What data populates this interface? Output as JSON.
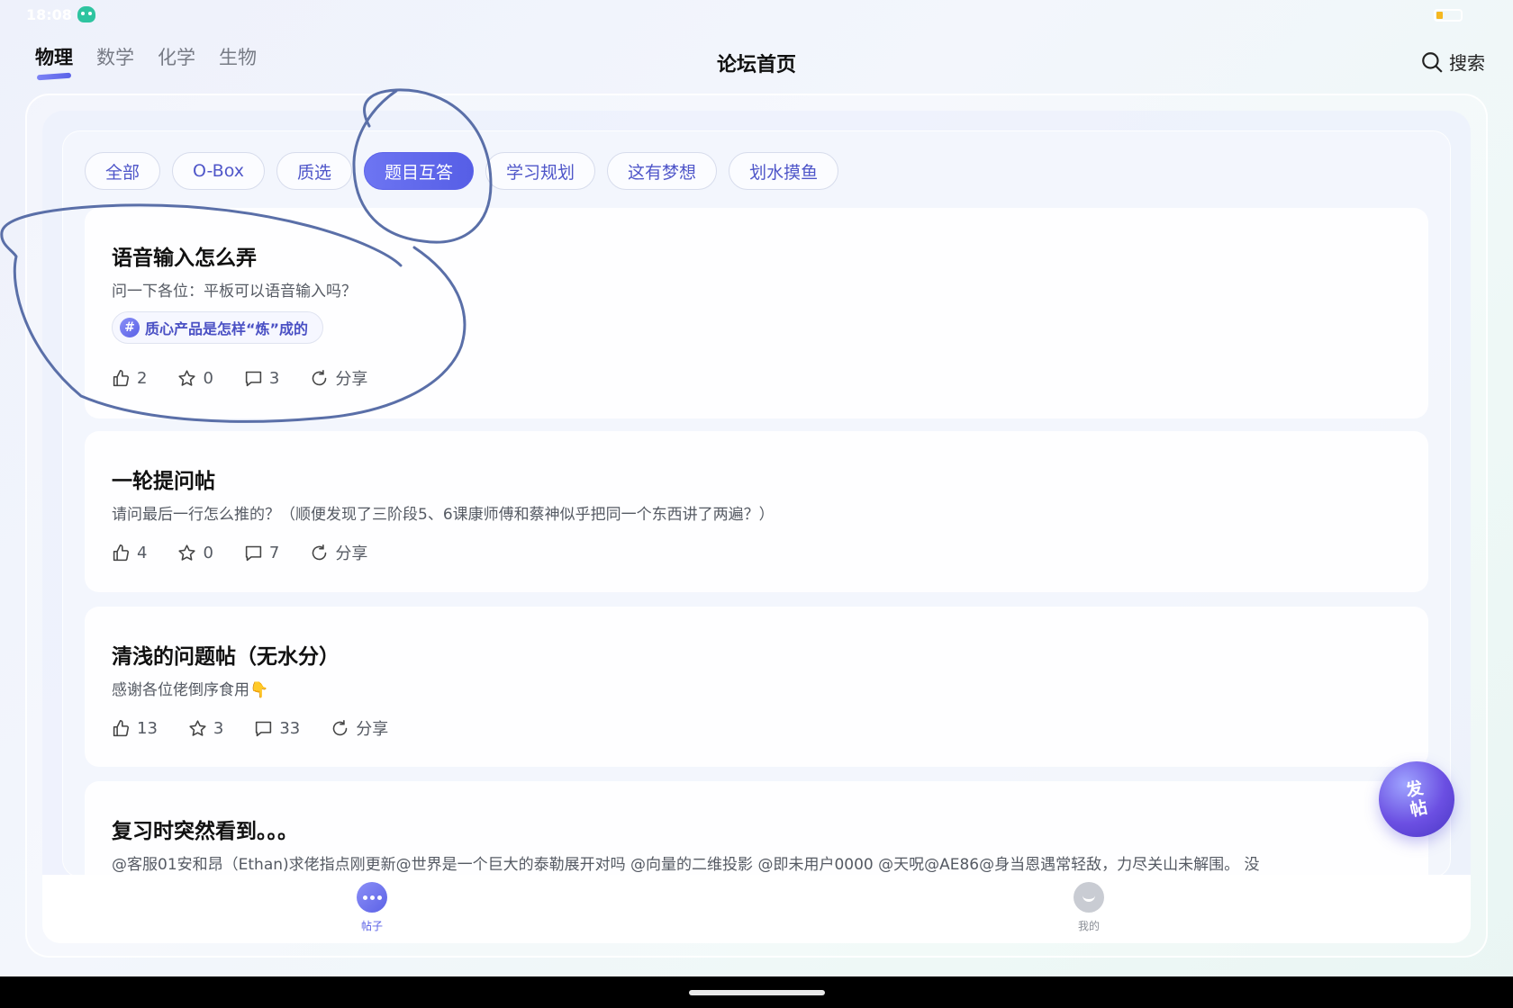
{
  "status_bar": {
    "time": "18:08"
  },
  "header": {
    "subject_tabs": [
      "物理",
      "数学",
      "化学",
      "生物"
    ],
    "active_subject": "物理",
    "title": "论坛首页",
    "search_label": "搜索"
  },
  "chips": [
    "全部",
    "O-Box",
    "质选",
    "题目互答",
    "学习规划",
    "这有梦想",
    "划水摸鱼"
  ],
  "active_chip": "题目互答",
  "posts": [
    {
      "title": "语音输入怎么弄",
      "body": "问一下各位：平板可以语音输入吗？",
      "tag": "质心产品是怎样“炼”成的",
      "likes": "2",
      "favorites": "0",
      "comments": "3",
      "share": "分享"
    },
    {
      "title": "一轮提问帖",
      "body": "请问最后一行怎么推的？（顺便发现了三阶段5、6课康师傅和蔡神似乎把同一个东西讲了两遍？）",
      "likes": "4",
      "favorites": "0",
      "comments": "7",
      "share": "分享"
    },
    {
      "title": "清浅的问题帖（无水分）",
      "body": "感谢各位佬倒序食用👇",
      "likes": "13",
      "favorites": "3",
      "comments": "33",
      "share": "分享"
    },
    {
      "title": "复习时突然看到。。。",
      "body": "@客服01安和昂（Ethan)求佬指点刚更新@世界是一个巨大的泰勒展开对吗 @向量的二维投影 @即未用户0000 @天呪@AE86@身当恩遇常轻敌，力尽关山未解围。 没"
    }
  ],
  "fab_label": "发帖",
  "bottom_nav": {
    "posts_label": "帖子",
    "me_label": "我的"
  },
  "colors": {
    "accent": "#5a61e6",
    "annotation_ink": "#5a6fa8"
  }
}
